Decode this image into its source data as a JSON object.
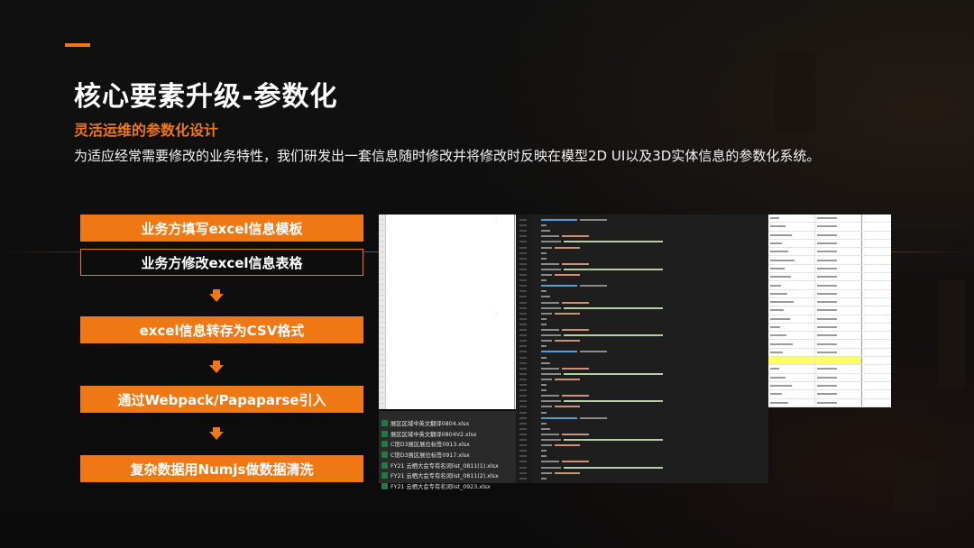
{
  "slide": {
    "title": "核心要素升级-参数化",
    "subtitle": "灵活运维的参数化设计",
    "description": "为适应经常需要修改的业务特性，我们研发出一套信息随时修改并将修改时反映在模型2D UI以及3D实体信息的参数化系统。"
  },
  "steps": [
    "业务方填写excel信息模板",
    "业务方修改excel信息表格",
    "excel信息转存为CSV格式",
    "通过Webpack/Papaparse引入",
    "复杂数据用Numjs做数据清洗"
  ],
  "files": [
    "展区区域中英文翻译0804.xlsx",
    "展区区域中英文翻译0804V2.xlsx",
    "C馆D3展区展位标签0913.xlsx",
    "C馆D3展区展位标签0917.xlsx",
    "FY21 云栖大会专有名词list_0811(1).xlsx",
    "FY21 云栖大会专有名词list_0811(2).xlsx",
    "FY21 云栖大会专有名词list_0923.xlsx"
  ],
  "colors": {
    "accent": "#f07814",
    "background": "#0d0d0d"
  },
  "icons": {
    "file": "excel-file-icon",
    "flow_arrow": "down-arrow-icon"
  }
}
